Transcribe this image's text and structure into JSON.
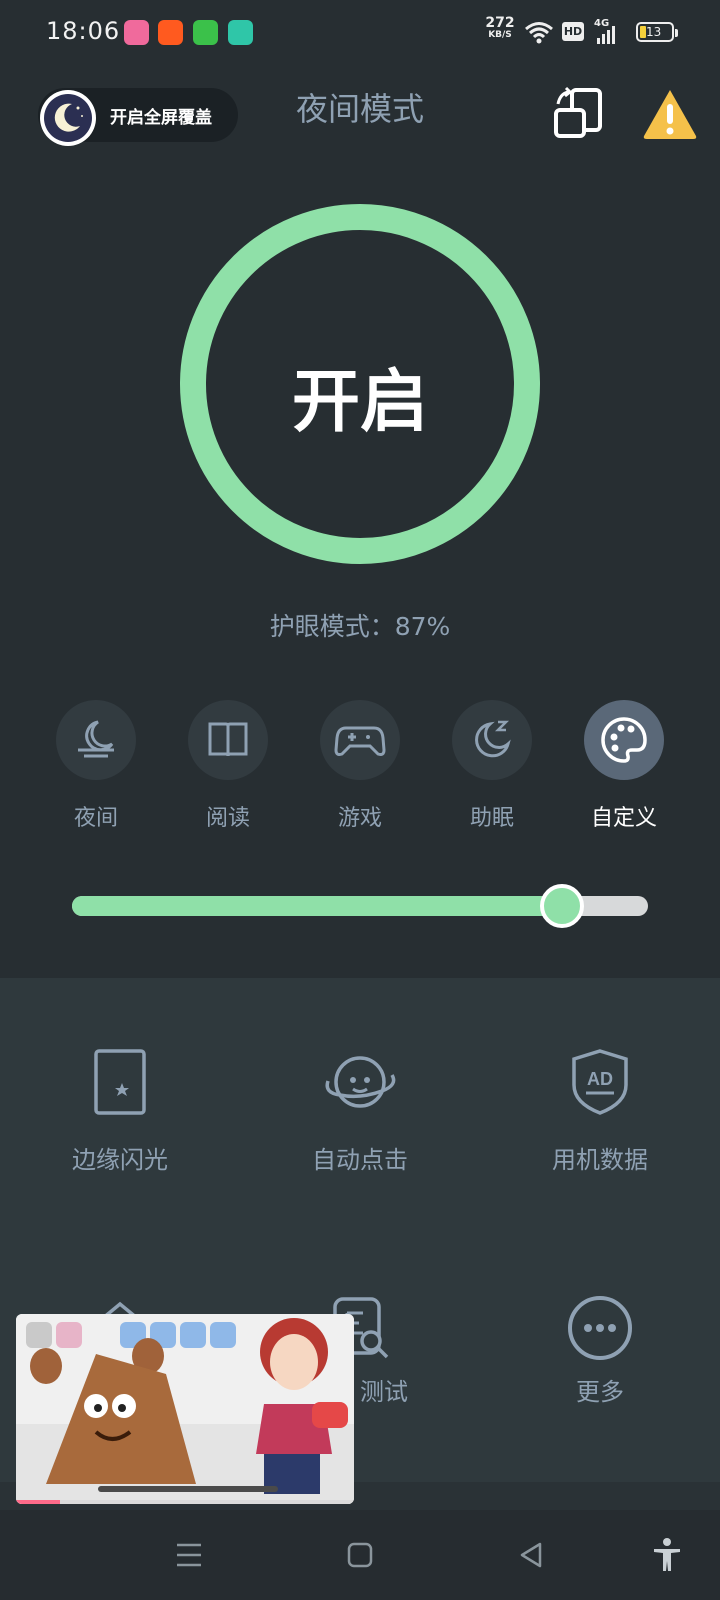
{
  "status_bar": {
    "time": "18:06",
    "net_speed_value": "272",
    "net_speed_unit": "KB/S",
    "hd_label": "HD",
    "signal_label": "4G",
    "battery": "13"
  },
  "header": {
    "overlay_button_label": "开启全屏覆盖",
    "title": "夜间模式"
  },
  "power": {
    "label": "开启",
    "ring_color": "#8fe0a8"
  },
  "eye_status": "护眼模式：87%",
  "modes": [
    {
      "label": "夜间",
      "icon": "night-icon",
      "active": false
    },
    {
      "label": "阅读",
      "icon": "book-icon",
      "active": false
    },
    {
      "label": "游戏",
      "icon": "gamepad-icon",
      "active": false
    },
    {
      "label": "助眠",
      "icon": "sleep-moon-icon",
      "active": false
    },
    {
      "label": "自定义",
      "icon": "palette-icon",
      "active": true
    }
  ],
  "slider": {
    "value_fraction": 0.85
  },
  "tools": [
    {
      "label": "边缘闪光",
      "icon": "edge-flash-icon"
    },
    {
      "label": "自动点击",
      "icon": "auto-click-icon"
    },
    {
      "label": "用机数据",
      "icon": "ad-shield-icon"
    },
    {
      "label": "测试",
      "icon": "test-search-icon"
    },
    {
      "label": "更多",
      "icon": "more-icon"
    }
  ],
  "pip": {
    "progress_fraction": 0.13
  },
  "colors": {
    "background": "#272e32",
    "accent": "#8fe0a8",
    "muted_text": "#8fa1b3",
    "panel": "#2f393d",
    "warning": "#f5c14a"
  }
}
